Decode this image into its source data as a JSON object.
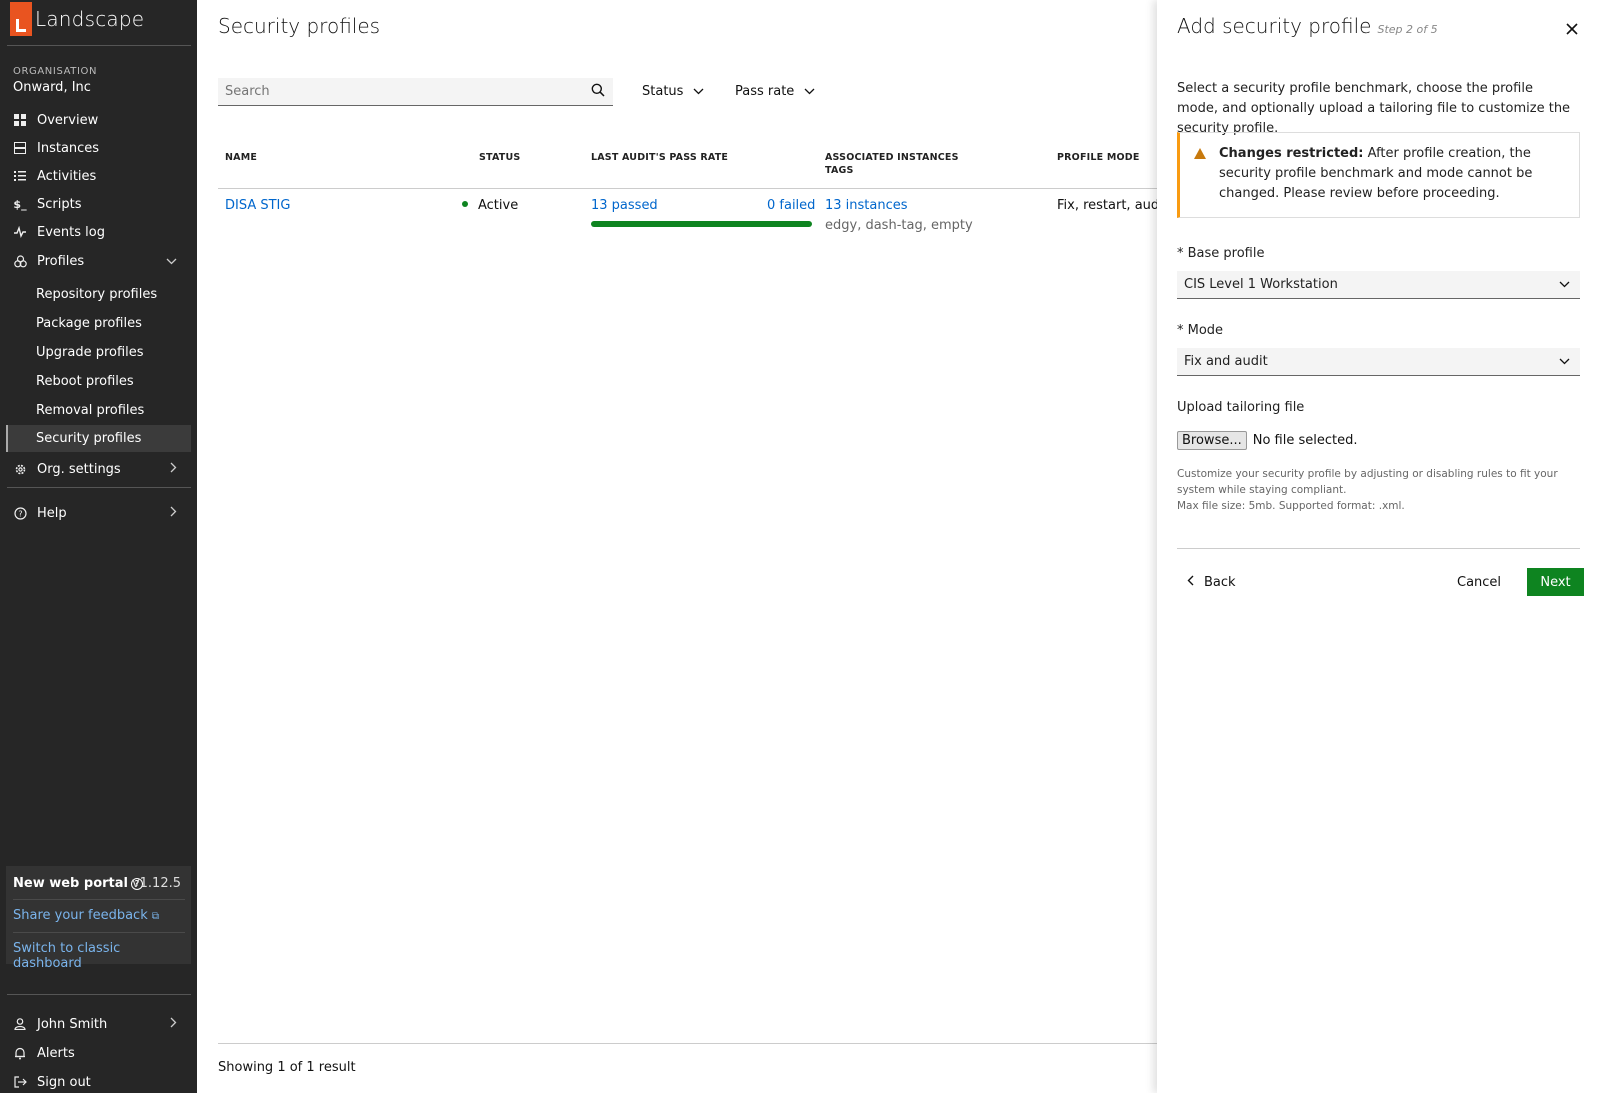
{
  "app": {
    "name": "Landscape"
  },
  "sidebar": {
    "org_label": "ORGANISATION",
    "org_name": "Onward, Inc",
    "items": [
      {
        "label": "Overview",
        "icon": "grid-icon"
      },
      {
        "label": "Instances",
        "icon": "server-icon"
      },
      {
        "label": "Activities",
        "icon": "list-icon"
      },
      {
        "label": "Scripts",
        "icon": "terminal-icon"
      },
      {
        "label": "Events log",
        "icon": "pulse-icon"
      },
      {
        "label": "Profiles",
        "icon": "profiles-icon"
      }
    ],
    "profile_subitems": [
      {
        "label": "Repository profiles"
      },
      {
        "label": "Package profiles"
      },
      {
        "label": "Upgrade profiles"
      },
      {
        "label": "Reboot profiles"
      },
      {
        "label": "Removal profiles"
      },
      {
        "label": "Security profiles"
      }
    ],
    "org_settings": "Org. settings",
    "help": "Help",
    "portal": {
      "title": "New web portal",
      "version": "v1.12.5",
      "feedback": "Share your feedback",
      "classic": "Switch to classic dashboard"
    },
    "user": "John Smith",
    "alerts": "Alerts",
    "sign_out": "Sign out"
  },
  "main": {
    "title": "Security profiles",
    "search_placeholder": "Search",
    "filters": {
      "status": "Status",
      "pass_rate": "Pass rate"
    },
    "columns": {
      "name": "NAME",
      "status": "STATUS",
      "pass_rate": "LAST AUDIT'S PASS RATE",
      "instances": "ASSOCIATED INSTANCES",
      "tags": "TAGS",
      "mode": "PROFILE MODE"
    },
    "rows": [
      {
        "name": "DISA STIG",
        "status": "Active",
        "passed": "13 passed",
        "failed": "0 failed",
        "pass_fraction": 1.0,
        "instances": "13 instances",
        "tags": "edgy, dash-tag, empty",
        "mode": "Fix, restart, audit"
      }
    ],
    "footer": "Showing 1 of 1 result"
  },
  "panel": {
    "title": "Add security profile",
    "step": "Step 2 of 5",
    "intro": "Select a security profile benchmark, choose the profile mode, and optionally upload a tailoring file to customize the security profile.",
    "notice_title": "Changes restricted:",
    "notice_text": "After profile creation, the security profile benchmark and mode cannot be changed. Please review before proceeding.",
    "base_profile_label": "* Base profile",
    "base_profile_value": "CIS Level 1 Workstation",
    "mode_label": "* Mode",
    "mode_value": "Fix and audit",
    "upload_label": "Upload tailoring file",
    "browse": "Browse...",
    "no_file": "No file selected.",
    "help_line1": "Customize your security profile by adjusting or disabling rules to fit your system while staying compliant.",
    "help_line2": "Max file size: 5mb. Supported format: .xml.",
    "back": "Back",
    "cancel": "Cancel",
    "next": "Next"
  },
  "colors": {
    "sidebar_bg": "#262626",
    "brand": "#e95420",
    "accent_green": "#0e8420",
    "link": "#0066cc",
    "warning": "#f99b11"
  }
}
